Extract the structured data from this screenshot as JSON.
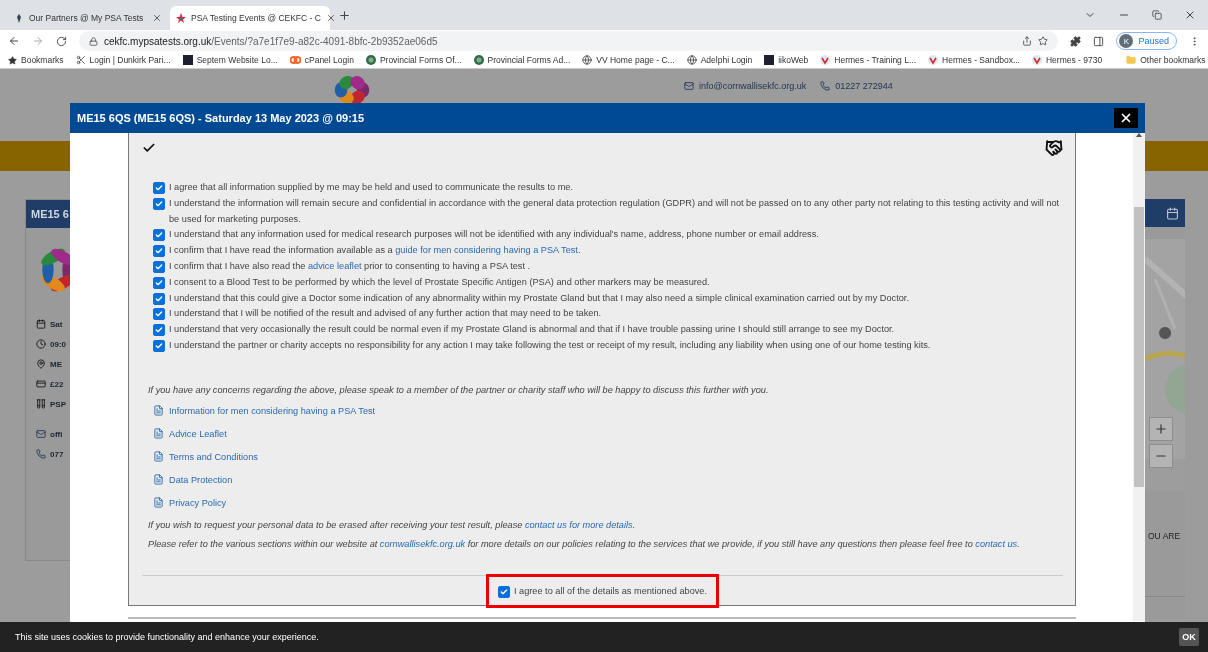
{
  "browser": {
    "tabs": [
      {
        "title": "Our Partners @ My PSA Tests",
        "selected": false
      },
      {
        "title": "PSA Testing Events @ CEKFC - C",
        "selected": true
      }
    ],
    "url": {
      "domain": "cekfc.mypsatests.org.uk",
      "path": "/Events/?a7e1f7e9-a82c-4091-8bfc-2b9352ae06d5"
    },
    "profile": {
      "initial": "K",
      "status": "Paused"
    },
    "bookmarks": [
      {
        "kind": "star",
        "label": "Bookmarks"
      },
      {
        "kind": "tool",
        "label": "Login | Dunkirk Pari..."
      },
      {
        "kind": "app",
        "label": "Septem Website Lo..."
      },
      {
        "kind": "cpanel",
        "label": "cPanel Login"
      },
      {
        "kind": "emblem",
        "label": "Provincial Forms Of..."
      },
      {
        "kind": "emblem",
        "label": "Provincial Forms Ad..."
      },
      {
        "kind": "globe",
        "label": "VV Home page - C..."
      },
      {
        "kind": "globe",
        "label": "Adelphi Login"
      },
      {
        "kind": "app",
        "label": "iikoWeb"
      },
      {
        "kind": "hermes",
        "label": "Hermes - Training L..."
      },
      {
        "kind": "hermes",
        "label": "Hermes - Sandbox..."
      },
      {
        "kind": "hermes",
        "label": "Hermes - 9730"
      }
    ],
    "other_bookmarks": "Other bookmarks"
  },
  "page": {
    "header": {
      "email": "info@cornwallisekfc.org.uk",
      "phone": "01227 272944"
    },
    "left_card": {
      "title": "ME15 6",
      "rows": [
        {
          "kind": "calendar",
          "text": "Sat"
        },
        {
          "kind": "clock",
          "text": "09:0"
        },
        {
          "kind": "pin",
          "text": "ME"
        },
        {
          "kind": "card",
          "text": "£22"
        },
        {
          "kind": "tubes",
          "text": "PSP"
        },
        {
          "kind": "mail",
          "text": "offi"
        },
        {
          "kind": "phone",
          "text": "077"
        }
      ]
    },
    "right_card": {
      "text": "OU ARE"
    }
  },
  "modal": {
    "title": "ME15 6QS (ME15 6QS) - Saturday 13 May 2023 @ 09:15",
    "consents": [
      {
        "checked": true,
        "segments": [
          {
            "kind": "text",
            "text": "I agree that all information supplied by me may be held and used to communicate the results to me."
          }
        ]
      },
      {
        "checked": true,
        "segments": [
          {
            "kind": "text",
            "text": "I understand the information will remain secure and confidential in accordance with the general data protection regulation (GDPR) and will not be passed on to any other party not relating to this testing activity and will not be used for marketing purposes."
          }
        ]
      },
      {
        "checked": true,
        "segments": [
          {
            "kind": "text",
            "text": "I understand that any information used for medical research purposes will not be identified with any individual's name, address, phone number or email address."
          }
        ]
      },
      {
        "checked": true,
        "segments": [
          {
            "kind": "text",
            "text": "I confirm that I have read the information available as a "
          },
          {
            "kind": "link",
            "text": "guide for men considering having a PSA Test"
          },
          {
            "kind": "text",
            "text": "."
          }
        ]
      },
      {
        "checked": true,
        "segments": [
          {
            "kind": "text",
            "text": "I confirm that I have also read the "
          },
          {
            "kind": "link",
            "text": "advice leaflet"
          },
          {
            "kind": "text",
            "text": " prior to consenting to having a PSA test ."
          }
        ]
      },
      {
        "checked": true,
        "segments": [
          {
            "kind": "text",
            "text": "I consent to a Blood Test to be performed by which the level of Prostate Specific Antigen (PSA) and other markers may be measured."
          }
        ]
      },
      {
        "checked": true,
        "segments": [
          {
            "kind": "text",
            "text": "I understand that this could give a Doctor some indication of any abnormality within my Prostate Gland but that I may also need a simple clinical examination carried out by my Doctor."
          }
        ]
      },
      {
        "checked": true,
        "segments": [
          {
            "kind": "text",
            "text": "I understand that I will be notified of the result and advised of any further action that may need to be taken."
          }
        ]
      },
      {
        "checked": true,
        "segments": [
          {
            "kind": "text",
            "text": "I understand that very occasionally the result could be normal even if my Prostate Gland is abnormal and that if I have trouble passing urine I should still arrange to see my Doctor."
          }
        ]
      },
      {
        "checked": true,
        "segments": [
          {
            "kind": "text",
            "text": "I understand the partner or charity accepts no responsibility for any action I may take following the test or receipt of my result, including any liability when using one of our home testing kits."
          }
        ]
      }
    ],
    "concerns": [
      {
        "kind": "text",
        "text": "If you have any concerns regarding the above, please speak to a member of the partner or charity staff who will be happy to discuss this further with you."
      }
    ],
    "documents": [
      {
        "label": "Information for men considering having a PSA Test"
      },
      {
        "label": "Advice Leaflet"
      },
      {
        "label": "Terms and Conditions"
      },
      {
        "label": "Data Protection"
      },
      {
        "label": "Privacy Policy"
      }
    ],
    "notes": [
      [
        {
          "kind": "text",
          "text": "If you wish to request your personal data to be erased after receiving your test result, please "
        },
        {
          "kind": "link",
          "text": "contact us for more details"
        },
        {
          "kind": "text",
          "text": "."
        }
      ],
      [
        {
          "kind": "text",
          "text": "Please refer to the various sections within our website at "
        },
        {
          "kind": "link",
          "text": "cornwallisekfc.org.uk"
        },
        {
          "kind": "text",
          "text": " for more details on our policies relating to the services that we provide, if you still have any questions then please feel free to "
        },
        {
          "kind": "link",
          "text": "contact us"
        },
        {
          "kind": "text",
          "text": "."
        }
      ]
    ],
    "agree": {
      "label": "I agree to all of the details as mentioned above.",
      "checked": true,
      "highlighted": true
    }
  },
  "cookie_bar": {
    "text": "This site uses cookies to provide functionality and enhance your experience.",
    "button": "OK"
  }
}
